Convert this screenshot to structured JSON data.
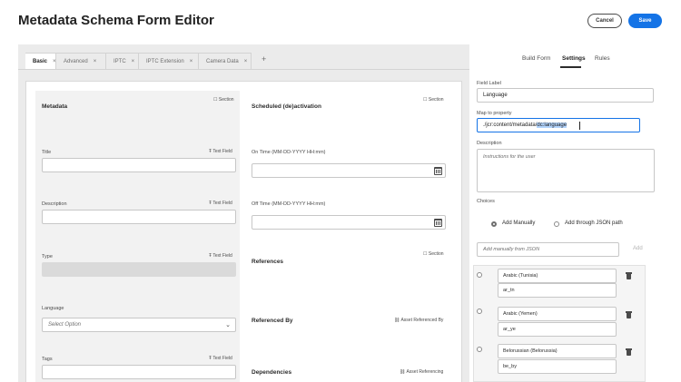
{
  "header": {
    "title": "Metadata Schema Form Editor",
    "cancel_label": "Cancel",
    "save_label": "Save",
    "accent_color": "#1473e6"
  },
  "tabs": [
    {
      "label": "Basic",
      "close": "×",
      "active": true
    },
    {
      "label": "Advanced",
      "close": "×"
    },
    {
      "label": "IPTC",
      "close": "×"
    },
    {
      "label": "IPTC Extension",
      "close": "×"
    },
    {
      "label": "Camera Data",
      "close": "×"
    }
  ],
  "add_tab": "+",
  "form": {
    "metadata_header": "Metadata",
    "section_tag": "Section",
    "title_label": "Title",
    "text_field_tag": "Text Field",
    "description_label": "Description",
    "type_label": "Type",
    "language_label": "Language",
    "language_select": "Select Option",
    "tags_label": "Tags",
    "scheduled_header": "Scheduled (de)activation",
    "on_time_label": "On Time (MM-DD-YYYY HH:mm)",
    "off_time_label": "Off Time (MM-DD-YYYY HH:mm)",
    "references_header": "References",
    "referenced_by_header": "Referenced By",
    "asset_referenced_by_tag": "Asset Referenced By",
    "dependencies_header": "Dependencies",
    "asset_referencing_tag": "Asset Referencing"
  },
  "panel": {
    "tabs": [
      "Build Form",
      "Settings",
      "Rules"
    ],
    "active_tab": "Settings",
    "field_label_title": "Field Label",
    "field_label_value": "Language",
    "map_title": "Map to property",
    "map_value_prefix": "./jcr:content/metadata/",
    "map_value_selected": "dc:language",
    "description_title": "Description",
    "description_placeholder": "Instructions for the user",
    "choices_title": "Choices",
    "add_manually": "Add Manually",
    "add_json": "Add through JSON path",
    "json_placeholder": "Add manually from JSON",
    "add_button": "Add",
    "choices": [
      {
        "text": "Arabic (Tunisia)",
        "value": "ar_tn"
      },
      {
        "text": "Arabic (Yemen)",
        "value": "ar_ye"
      },
      {
        "text": "Belorussian (Belorussia)",
        "value": "be_by"
      }
    ]
  }
}
